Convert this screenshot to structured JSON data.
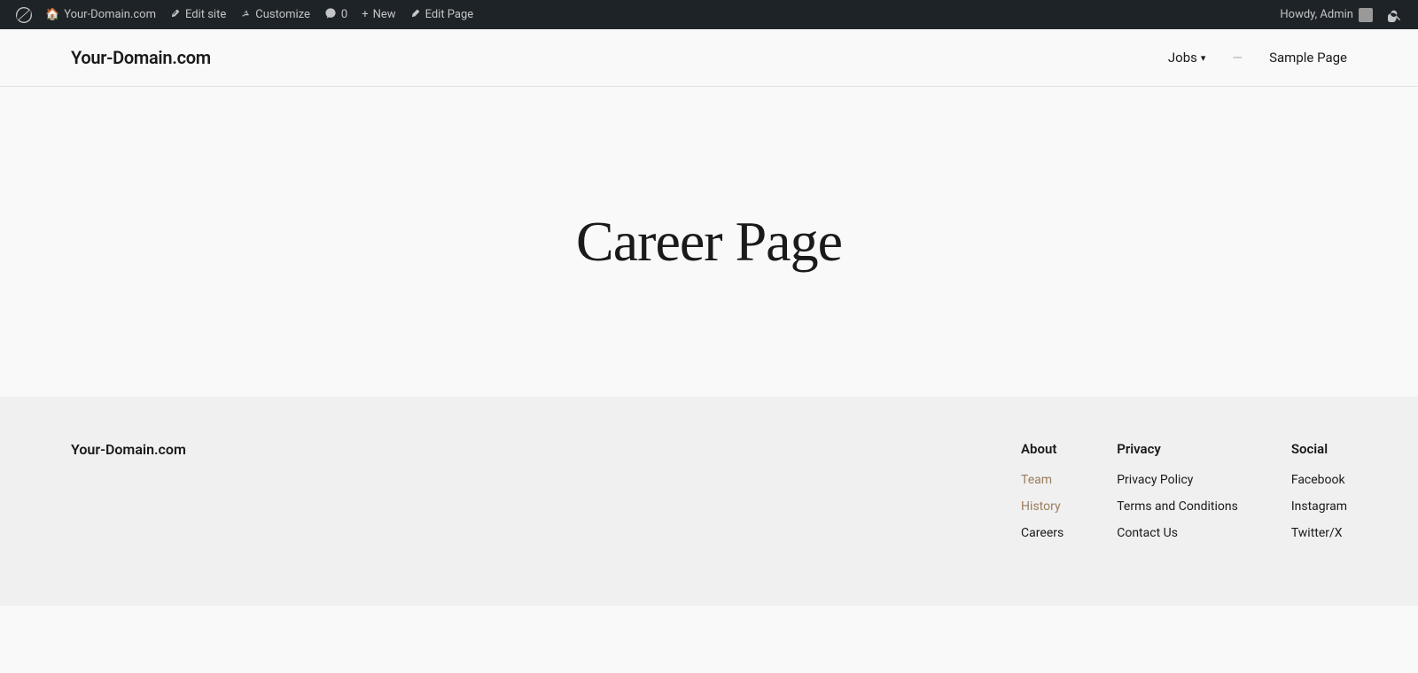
{
  "adminBar": {
    "wpLogoLabel": "WordPress",
    "items": [
      {
        "id": "your-domain",
        "label": "Your-Domain.com",
        "icon": "🏠"
      },
      {
        "id": "edit-site",
        "label": "Edit site",
        "icon": "✏️"
      },
      {
        "id": "customize",
        "label": "Customize",
        "icon": "✏️"
      },
      {
        "id": "comments",
        "label": "0",
        "icon": "💬"
      },
      {
        "id": "new",
        "label": "New",
        "icon": "+"
      },
      {
        "id": "edit-page",
        "label": "Edit Page",
        "icon": "✏️"
      }
    ],
    "howdy": "Howdy, Admin",
    "searchTooltip": "Search"
  },
  "siteHeader": {
    "logo": "Your-Domain.com",
    "nav": [
      {
        "id": "jobs",
        "label": "Jobs",
        "hasDropdown": true
      },
      {
        "id": "sample-page",
        "label": "Sample Page",
        "hasDropdown": false
      }
    ]
  },
  "mainContent": {
    "pageTitle": "Career Page"
  },
  "footer": {
    "brandName": "Your-Domain.com",
    "columns": [
      {
        "id": "about",
        "title": "About",
        "links": [
          {
            "label": "Team",
            "style": "muted"
          },
          {
            "label": "History",
            "style": "muted"
          },
          {
            "label": "Careers",
            "style": "dark"
          }
        ]
      },
      {
        "id": "privacy",
        "title": "Privacy",
        "links": [
          {
            "label": "Privacy Policy",
            "style": "dark"
          },
          {
            "label": "Terms and Conditions",
            "style": "dark"
          },
          {
            "label": "Contact Us",
            "style": "dark"
          }
        ]
      },
      {
        "id": "social",
        "title": "Social",
        "links": [
          {
            "label": "Facebook",
            "style": "dark"
          },
          {
            "label": "Instagram",
            "style": "dark"
          },
          {
            "label": "Twitter/X",
            "style": "dark"
          }
        ]
      }
    ]
  }
}
